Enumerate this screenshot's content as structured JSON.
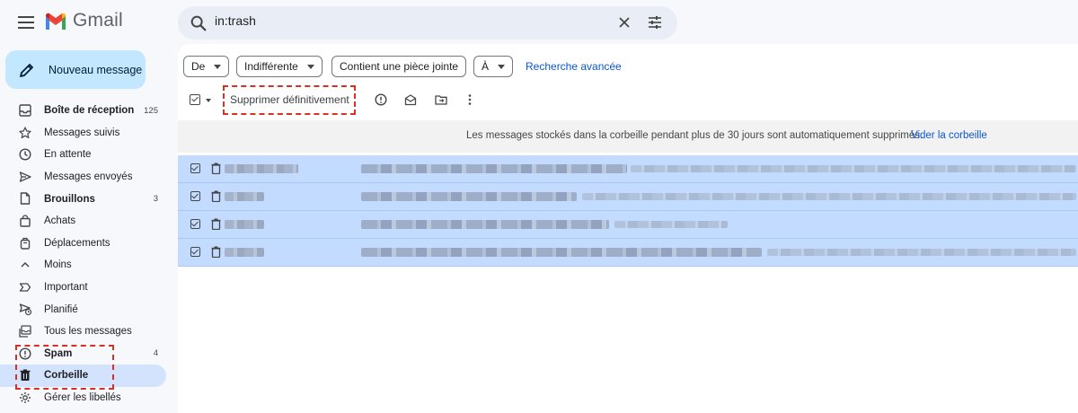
{
  "app": {
    "name": "Gmail"
  },
  "search": {
    "query": "in:trash"
  },
  "compose": {
    "label": "Nouveau message"
  },
  "sidebar": {
    "items": [
      {
        "label": "Boîte de réception",
        "count": "125",
        "icon": "inbox-icon"
      },
      {
        "label": "Messages suivis",
        "count": "",
        "icon": "star-icon"
      },
      {
        "label": "En attente",
        "count": "",
        "icon": "clock-icon"
      },
      {
        "label": "Messages envoyés",
        "count": "",
        "icon": "send-icon"
      },
      {
        "label": "Brouillons",
        "count": "3",
        "icon": "draft-icon"
      },
      {
        "label": "Achats",
        "count": "",
        "icon": "purchases-icon"
      },
      {
        "label": "Déplacements",
        "count": "",
        "icon": "luggage-icon"
      },
      {
        "label": "Moins",
        "count": "",
        "icon": "chevron-up-icon"
      },
      {
        "label": "Important",
        "count": "",
        "icon": "important-icon"
      },
      {
        "label": "Planifié",
        "count": "",
        "icon": "scheduled-icon"
      },
      {
        "label": "Tous les messages",
        "count": "",
        "icon": "all-mail-icon"
      },
      {
        "label": "Spam",
        "count": "4",
        "icon": "spam-icon"
      },
      {
        "label": "Corbeille",
        "count": "",
        "icon": "trash-icon"
      },
      {
        "label": "Gérer les libellés",
        "count": "",
        "icon": "settings-icon"
      }
    ],
    "active": "Corbeille"
  },
  "filters": {
    "from": "De",
    "time": "Indifférente",
    "attachment": "Contient une pièce jointe",
    "to": "À",
    "advanced": "Recherche avancée"
  },
  "toolbar": {
    "delete_forever": "Supprimer définitivement"
  },
  "banner": {
    "text": "Les messages stockés dans la corbeille pendant plus de 30 jours sont automatiquement supprimés.",
    "link": "Vider la corbeille"
  },
  "messages": {
    "selected": true,
    "count": 4
  },
  "colors": {
    "accent": "#0b57d0",
    "compose_bg": "#c2e7ff",
    "active_nav": "#d3e3fd",
    "selected_row": "#c2dbff",
    "annotation_red": "#d93025"
  }
}
